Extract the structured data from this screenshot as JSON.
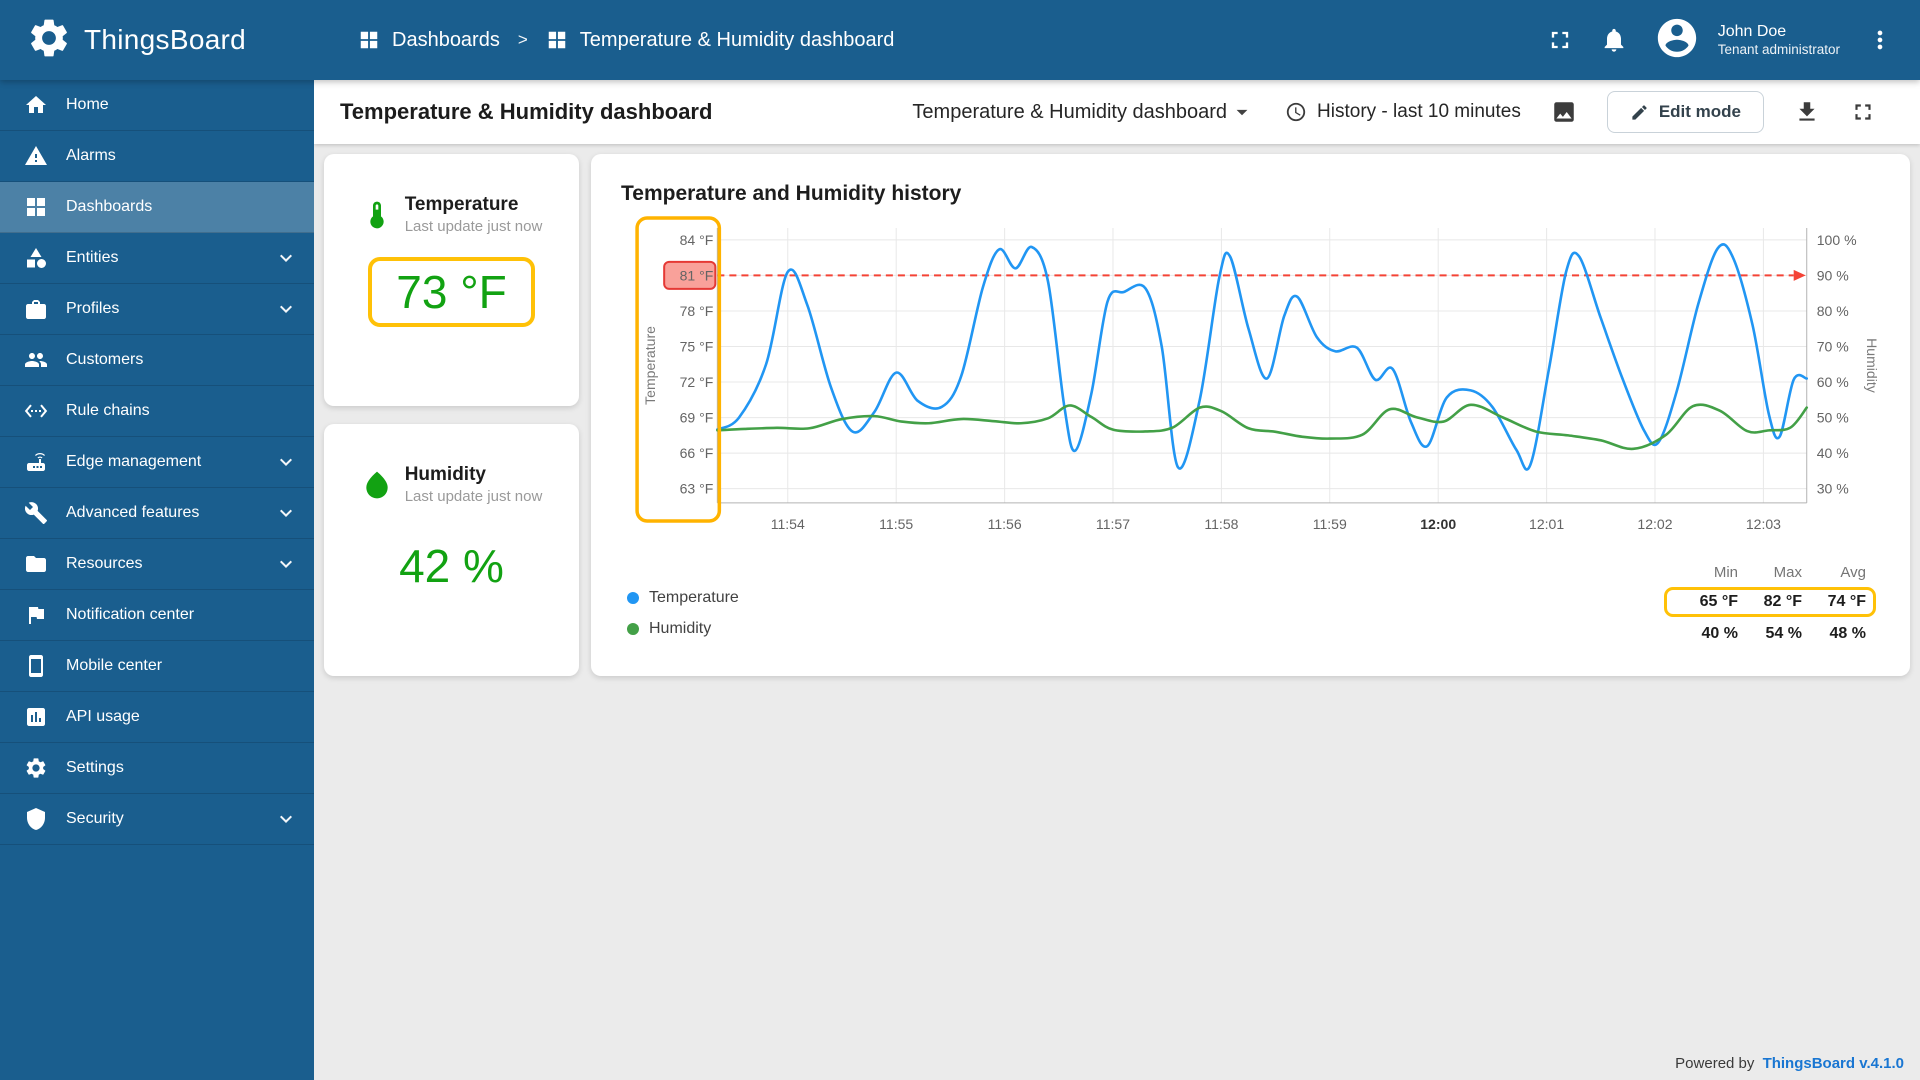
{
  "brand": "ThingsBoard",
  "header": {
    "breadcrumb": [
      "Dashboards",
      "Temperature & Humidity dashboard"
    ],
    "separator": ">",
    "user_name": "John Doe",
    "user_role": "Tenant administrator"
  },
  "sidebar": [
    {
      "label": "Home",
      "icon": "home"
    },
    {
      "label": "Alarms",
      "icon": "alarms"
    },
    {
      "label": "Dashboards",
      "icon": "dashboards",
      "active": true
    },
    {
      "label": "Entities",
      "icon": "entities",
      "expand": true
    },
    {
      "label": "Profiles",
      "icon": "profiles",
      "expand": true
    },
    {
      "label": "Customers",
      "icon": "customers"
    },
    {
      "label": "Rule chains",
      "icon": "rule-chains"
    },
    {
      "label": "Edge management",
      "icon": "edge",
      "expand": true
    },
    {
      "label": "Advanced features",
      "icon": "advanced",
      "expand": true
    },
    {
      "label": "Resources",
      "icon": "resources",
      "expand": true
    },
    {
      "label": "Notification center",
      "icon": "notification"
    },
    {
      "label": "Mobile center",
      "icon": "mobile"
    },
    {
      "label": "API usage",
      "icon": "api"
    },
    {
      "label": "Settings",
      "icon": "settings"
    },
    {
      "label": "Security",
      "icon": "security",
      "expand": true
    }
  ],
  "toolbar": {
    "title": "Temperature & Humidity dashboard",
    "dashboard_select": "Temperature & Humidity dashboard",
    "history_label": "History - last 10 minutes",
    "edit_label": "Edit mode"
  },
  "cards": {
    "temperature": {
      "title": "Temperature",
      "subtitle": "Last update just now",
      "value": "73 °F"
    },
    "humidity": {
      "title": "Humidity",
      "subtitle": "Last update just now",
      "value": "42 %"
    }
  },
  "chart_data": {
    "type": "line",
    "title": "Temperature and Humidity history",
    "x_tick_labels": [
      "11:54",
      "11:55",
      "11:56",
      "11:57",
      "11:58",
      "11:59",
      "12:00",
      "12:01",
      "12:02",
      "12:03"
    ],
    "x_bold_tick": "12:00",
    "x_domain_minutes": [
      -0.65,
      9.4
    ],
    "left_axis": {
      "label": "Temperature",
      "unit": "°F",
      "min": 63,
      "max": 84,
      "ticks": [
        84,
        81,
        78,
        75,
        72,
        69,
        66,
        63
      ]
    },
    "right_axis": {
      "label": "Humidity",
      "unit": "%",
      "min": 30,
      "max": 100,
      "ticks": [
        100,
        90,
        80,
        70,
        60,
        50,
        40,
        30
      ]
    },
    "threshold": {
      "axis": "left",
      "value": 81,
      "label": "81 °F"
    },
    "series": [
      {
        "name": "Temperature",
        "axis": "left",
        "color": "#2196f3",
        "points": [
          [
            -0.65,
            68
          ],
          [
            -0.45,
            69
          ],
          [
            -0.2,
            73.5
          ],
          [
            0,
            81.3
          ],
          [
            0.18,
            78.5
          ],
          [
            0.4,
            71.5
          ],
          [
            0.6,
            67.8
          ],
          [
            0.8,
            69.5
          ],
          [
            1,
            72.8
          ],
          [
            1.2,
            70.4
          ],
          [
            1.42,
            69.9
          ],
          [
            1.6,
            72.5
          ],
          [
            1.8,
            80
          ],
          [
            1.95,
            83.2
          ],
          [
            2.1,
            81.6
          ],
          [
            2.25,
            83.4
          ],
          [
            2.4,
            80.5
          ],
          [
            2.55,
            70
          ],
          [
            2.65,
            66.2
          ],
          [
            2.8,
            71
          ],
          [
            2.95,
            78.8
          ],
          [
            3.1,
            79.6
          ],
          [
            3.3,
            79.9
          ],
          [
            3.45,
            75
          ],
          [
            3.6,
            64.8
          ],
          [
            3.8,
            70.5
          ],
          [
            3.98,
            80.8
          ],
          [
            4.08,
            82.6
          ],
          [
            4.25,
            76.5
          ],
          [
            4.42,
            72.3
          ],
          [
            4.58,
            77.6
          ],
          [
            4.7,
            79.2
          ],
          [
            4.88,
            75.8
          ],
          [
            5.05,
            74.6
          ],
          [
            5.25,
            74.9
          ],
          [
            5.42,
            72.2
          ],
          [
            5.58,
            73.1
          ],
          [
            5.75,
            68.6
          ],
          [
            5.9,
            66.6
          ],
          [
            6.08,
            70.7
          ],
          [
            6.3,
            71.3
          ],
          [
            6.5,
            69.9
          ],
          [
            6.72,
            66.3
          ],
          [
            6.85,
            65
          ],
          [
            7.02,
            73
          ],
          [
            7.18,
            81.3
          ],
          [
            7.3,
            82.6
          ],
          [
            7.5,
            77.4
          ],
          [
            7.7,
            72.3
          ],
          [
            7.9,
            67.9
          ],
          [
            8.03,
            66.9
          ],
          [
            8.2,
            71.2
          ],
          [
            8.4,
            78.6
          ],
          [
            8.58,
            83.3
          ],
          [
            8.72,
            82.5
          ],
          [
            8.9,
            76.8
          ],
          [
            9.05,
            69.3
          ],
          [
            9.15,
            67.4
          ],
          [
            9.28,
            72.2
          ],
          [
            9.4,
            72.3
          ]
        ]
      },
      {
        "name": "Humidity",
        "axis": "right",
        "color": "#43a047",
        "points": [
          [
            -0.65,
            46.4
          ],
          [
            -0.4,
            46.8
          ],
          [
            -0.1,
            47.1
          ],
          [
            0.2,
            47
          ],
          [
            0.5,
            49.6
          ],
          [
            0.8,
            50.4
          ],
          [
            1.05,
            48.9
          ],
          [
            1.3,
            48.4
          ],
          [
            1.6,
            49.6
          ],
          [
            1.9,
            49
          ],
          [
            2.15,
            48.4
          ],
          [
            2.4,
            49.8
          ],
          [
            2.6,
            53.4
          ],
          [
            2.8,
            50.2
          ],
          [
            3,
            46.6
          ],
          [
            3.3,
            46.1
          ],
          [
            3.55,
            47.2
          ],
          [
            3.8,
            52.8
          ],
          [
            4,
            51.8
          ],
          [
            4.25,
            47
          ],
          [
            4.5,
            46
          ],
          [
            4.75,
            44.6
          ],
          [
            5,
            44.1
          ],
          [
            5.3,
            45.2
          ],
          [
            5.55,
            52.3
          ],
          [
            5.8,
            50.1
          ],
          [
            6.05,
            48.9
          ],
          [
            6.3,
            53.6
          ],
          [
            6.6,
            50
          ],
          [
            6.9,
            46.1
          ],
          [
            7.2,
            45
          ],
          [
            7.5,
            43.6
          ],
          [
            7.8,
            41.2
          ],
          [
            8.1,
            45.1
          ],
          [
            8.35,
            53.2
          ],
          [
            8.6,
            51.9
          ],
          [
            8.85,
            46.2
          ],
          [
            9.05,
            46.4
          ],
          [
            9.25,
            47.2
          ],
          [
            9.4,
            52.8
          ]
        ]
      }
    ]
  },
  "legend": {
    "columns": [
      "Min",
      "Max",
      "Avg"
    ],
    "rows": [
      {
        "name": "Temperature",
        "color": "#2196f3",
        "values": [
          "65 °F",
          "82 °F",
          "74 °F"
        ],
        "highlighted": true
      },
      {
        "name": "Humidity",
        "color": "#43a047",
        "values": [
          "40 %",
          "54 %",
          "48 %"
        ],
        "highlighted": false
      }
    ]
  },
  "footer": {
    "powered_by": "Powered by",
    "version": "ThingsBoard v.4.1.0"
  },
  "colors": {
    "primary": "#1A5E8E",
    "value_green": "#12a212",
    "accent_amber": "#ffc107",
    "threshold_red": "#f44336",
    "link_blue": "#1976d2"
  }
}
